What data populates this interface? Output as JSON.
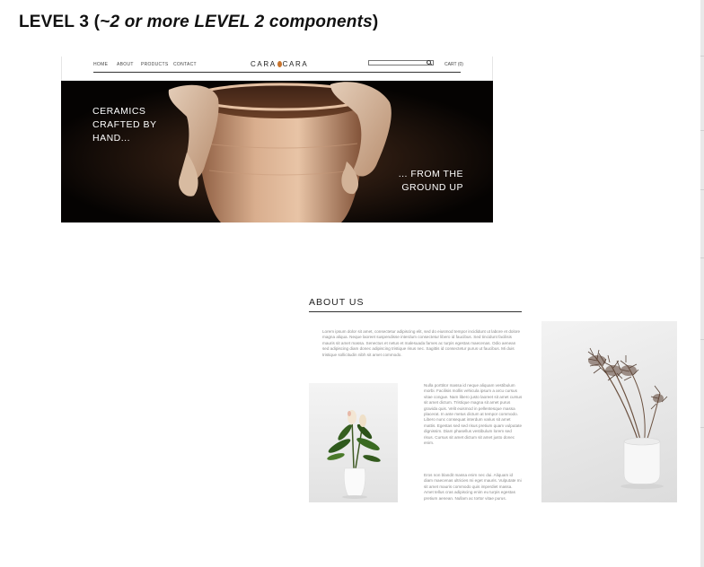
{
  "heading": {
    "level": "LEVEL 3",
    "note_open": " (",
    "note": "~2 or more LEVEL 2 components",
    "note_close": ")"
  },
  "site": {
    "nav": {
      "links": [
        "HOME",
        "ABOUT",
        "PRODUCTS",
        "CONTACT"
      ],
      "brand_left": "CARA",
      "brand_right": "CARA",
      "search_placeholder": "",
      "cart": "CART (0)"
    },
    "hero": {
      "left_text": "CERAMICS\nCRAFTED BY\nHAND...",
      "right_text": "... FROM THE\nGROUND UP"
    }
  },
  "about": {
    "title": "ABOUT US",
    "para1": "Lorem ipsum dolor sit amet, consectetur adipiscing elit, sed do eiusmod tempor incididunt ut labore et dolore magna aliqua. Neque laoreet suspendisse interdum consectetur libero id faucibus. Sed tincidunt facilisis mauris sit amet massa. Senectus et netus et malesuada fames ac turpis egestas maecenas. Odio aenean sed adipiscing diam donec adipiscing tristique risus nec. Sagittis id consectetur purus ut faucibus. Mi duis tristique sollicitudin nibh sit amet commodo.",
    "para2": "Nulla porttitor massa id neque aliquam vestibulum morbi. Facilisis mollis vehicula ipsum a arcu cursus vitae congue. Nam libero justo laoreet sit amet cursus sit amet dictum. Tristique magna sit amet purus gravida quis. Velit euismod in pellentesque massa placerat. In ante metus dictum at tempor commodo. Libero nunc consequat interdum varius sit amet mattis. Egestas sed sed risus pretium quam vulputate dignissim. Diam phasellus vestibulum lorem sed risus. Cursus sit amet dictum sit amet justo donec enim.",
    "para3": "Eros non blandit massa enim nec dui. Aliquam id diam maecenas ultricies mi eget mauris. Vulputate mi sit amet mauris commodo quis imperdiet massa. Amet tellus cras adipiscing enim eu turpis egestas pretium aenean. Nullam ac tortor vitae purus."
  },
  "colors": {
    "accent": "#c8742e",
    "hero_bg": "#050302",
    "clay": "#d4a784"
  }
}
